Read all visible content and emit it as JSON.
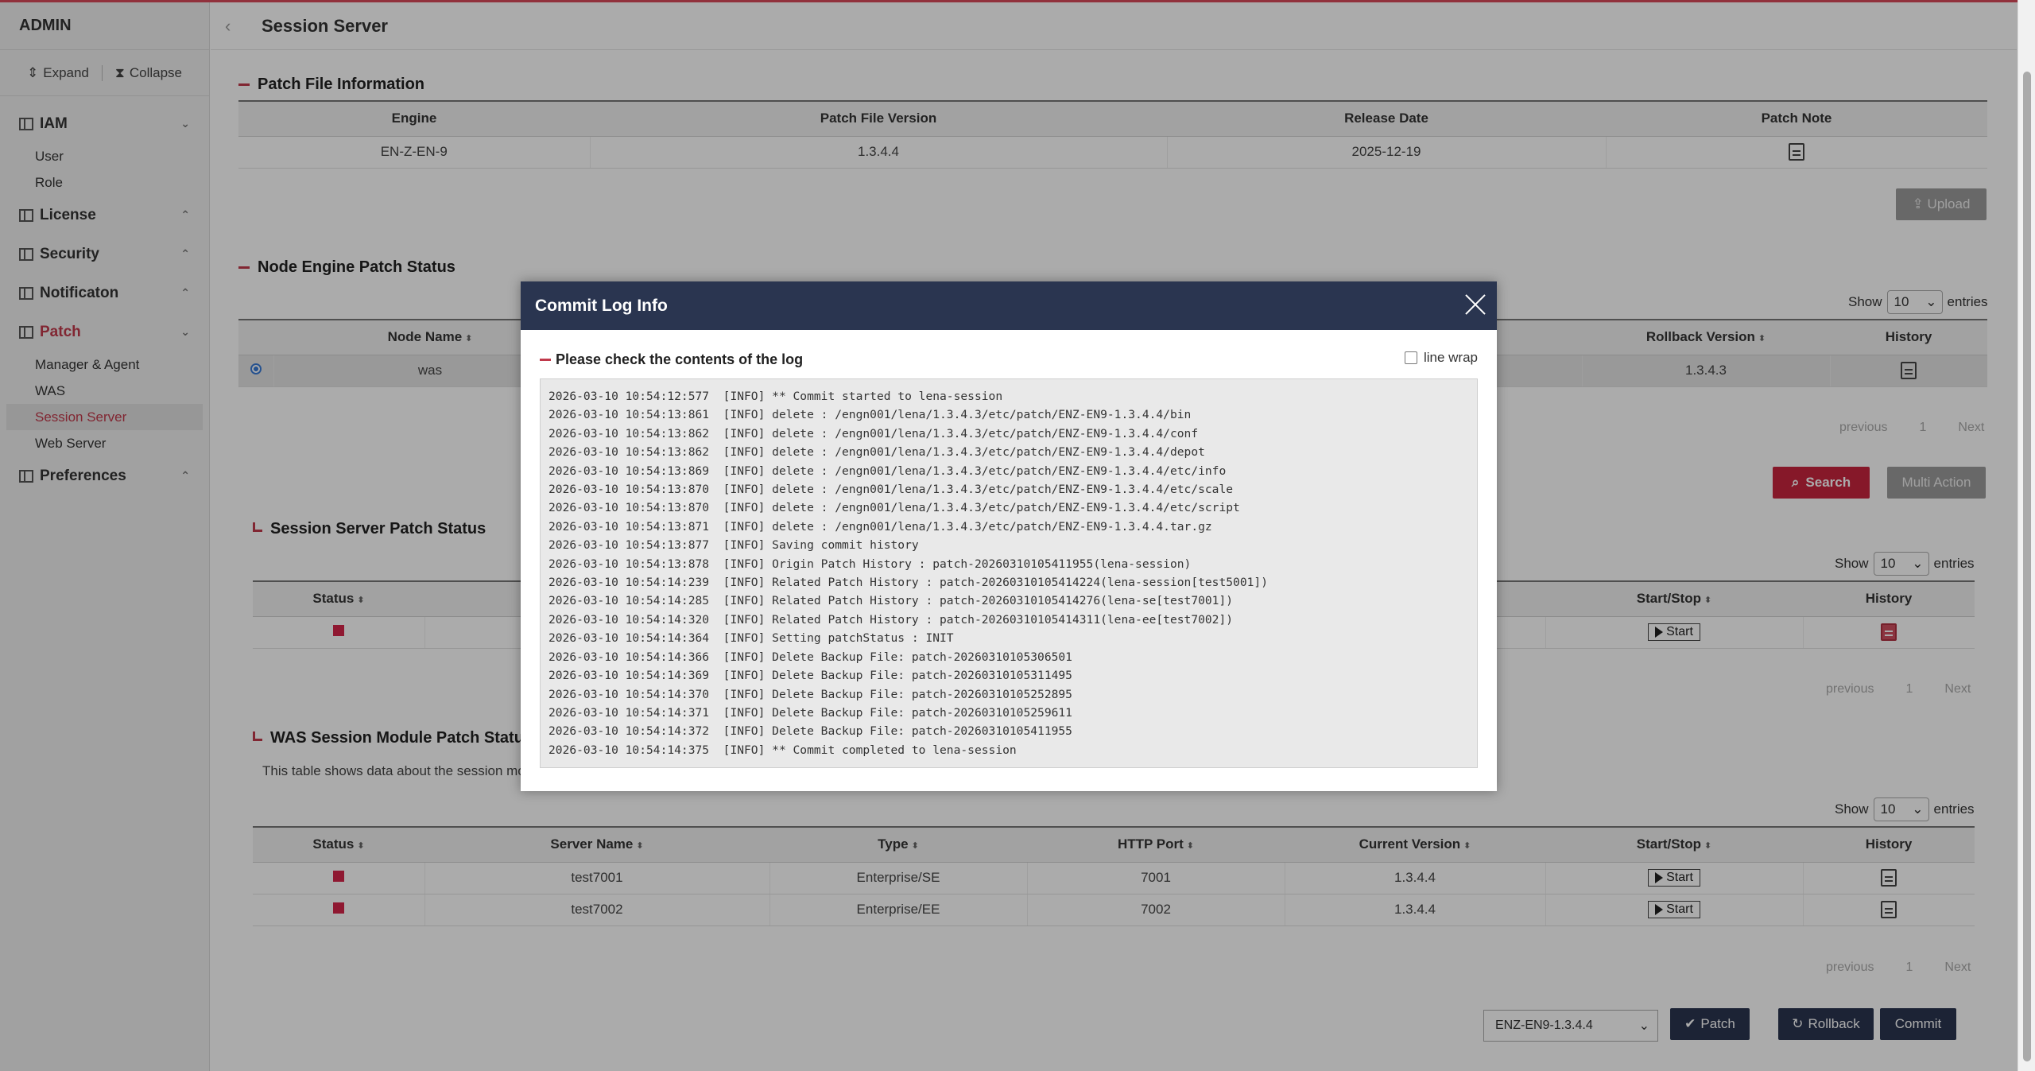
{
  "sidebar": {
    "title": "ADMIN",
    "expand_label": "Expand",
    "collapse_label": "Collapse",
    "menus": [
      {
        "label": "IAM",
        "chevron": "⌄",
        "items": [
          "User",
          "Role"
        ]
      },
      {
        "label": "License",
        "chevron": "⌃",
        "items": []
      },
      {
        "label": "Security",
        "chevron": "⌃",
        "items": []
      },
      {
        "label": "Notificaton",
        "chevron": "⌃",
        "items": []
      },
      {
        "label": "Patch",
        "chevron": "⌄",
        "items": [
          "Manager & Agent",
          "WAS",
          "Session Server",
          "Web Server"
        ]
      },
      {
        "label": "Preferences",
        "chevron": "⌃",
        "items": []
      }
    ]
  },
  "page": {
    "title": "Session Server"
  },
  "patch_file": {
    "title": "Patch File Information",
    "headers": [
      "Engine",
      "Patch File Version",
      "Release Date",
      "Patch Note"
    ],
    "row": [
      "EN-Z-EN-9",
      "1.3.4.4",
      "2025-12-19"
    ],
    "upload_label": "Upload"
  },
  "node_engine": {
    "title": "Node Engine Patch Status",
    "show": "Show",
    "entries": "entries",
    "page_size": "10",
    "headers": [
      "Node Name",
      "Rollback Version",
      "History"
    ],
    "row": {
      "name": "was",
      "rollback": "1.3.4.3"
    },
    "pager": {
      "prev": "previous",
      "page": "1",
      "next": "Next"
    },
    "search_label": "Search",
    "multi_label": "Multi Action"
  },
  "session_status": {
    "title": "Session Server Patch Status",
    "show": "Show",
    "entries": "entries",
    "page_size": "10",
    "headers": [
      "Status",
      "Start/Stop",
      "History"
    ],
    "start_label": "Start",
    "pager": {
      "prev": "previous",
      "page": "1",
      "next": "Next"
    }
  },
  "was_module": {
    "title": "WAS Session Module Patch Status",
    "desc": "This table shows data about the session mod",
    "show": "Show",
    "entries": "entries",
    "page_size": "10",
    "headers": [
      "Status",
      "Server Name",
      "Type",
      "HTTP Port",
      "Current Version",
      "Start/Stop",
      "History"
    ],
    "rows": [
      {
        "server": "test7001",
        "type": "Enterprise/SE",
        "port": "7001",
        "version": "1.3.4.4",
        "action": "Start"
      },
      {
        "server": "test7002",
        "type": "Enterprise/EE",
        "port": "7002",
        "version": "1.3.4.4",
        "action": "Start"
      }
    ],
    "pager": {
      "prev": "previous",
      "page": "1",
      "next": "Next"
    }
  },
  "footer": {
    "version_select": "ENZ-EN9-1.3.4.4",
    "patch_label": "Patch",
    "rollback_label": "Rollback",
    "commit_label": "Commit"
  },
  "modal": {
    "title": "Commit Log Info",
    "subtitle": "Please check the contents of the log",
    "wrap_label": "line wrap",
    "lines": [
      "2026-03-10 10:54:12:577  [INFO] ** Commit started to lena-session",
      "2026-03-10 10:54:13:861  [INFO] delete : /engn001/lena/1.3.4.3/etc/patch/ENZ-EN9-1.3.4.4/bin",
      "2026-03-10 10:54:13:862  [INFO] delete : /engn001/lena/1.3.4.3/etc/patch/ENZ-EN9-1.3.4.4/conf",
      "2026-03-10 10:54:13:862  [INFO] delete : /engn001/lena/1.3.4.3/etc/patch/ENZ-EN9-1.3.4.4/depot",
      "2026-03-10 10:54:13:869  [INFO] delete : /engn001/lena/1.3.4.3/etc/patch/ENZ-EN9-1.3.4.4/etc/info",
      "2026-03-10 10:54:13:870  [INFO] delete : /engn001/lena/1.3.4.3/etc/patch/ENZ-EN9-1.3.4.4/etc/scale",
      "2026-03-10 10:54:13:870  [INFO] delete : /engn001/lena/1.3.4.3/etc/patch/ENZ-EN9-1.3.4.4/etc/script",
      "2026-03-10 10:54:13:871  [INFO] delete : /engn001/lena/1.3.4.3/etc/patch/ENZ-EN9-1.3.4.4.tar.gz",
      "2026-03-10 10:54:13:877  [INFO] Saving commit history",
      "2026-03-10 10:54:13:878  [INFO] Origin Patch History : patch-20260310105411955(lena-session)",
      "2026-03-10 10:54:14:239  [INFO] Related Patch History : patch-20260310105414224(lena-session[test5001])",
      "2026-03-10 10:54:14:285  [INFO] Related Patch History : patch-20260310105414276(lena-se[test7001])",
      "2026-03-10 10:54:14:320  [INFO] Related Patch History : patch-20260310105414311(lena-ee[test7002])",
      "2026-03-10 10:54:14:364  [INFO] Setting patchStatus : INIT",
      "2026-03-10 10:54:14:366  [INFO] Delete Backup File: patch-20260310105306501",
      "2026-03-10 10:54:14:369  [INFO] Delete Backup File: patch-20260310105311495",
      "2026-03-10 10:54:14:370  [INFO] Delete Backup File: patch-20260310105252895",
      "2026-03-10 10:54:14:371  [INFO] Delete Backup File: patch-20260310105259611",
      "2026-03-10 10:54:14:372  [INFO] Delete Backup File: patch-20260310105411955",
      "2026-03-10 10:54:14:375  [INFO] ** Commit completed to lena-session"
    ]
  },
  "colors": {
    "accent": "#c8243e",
    "navy": "#2a3550",
    "status_red": "#d6244a"
  }
}
